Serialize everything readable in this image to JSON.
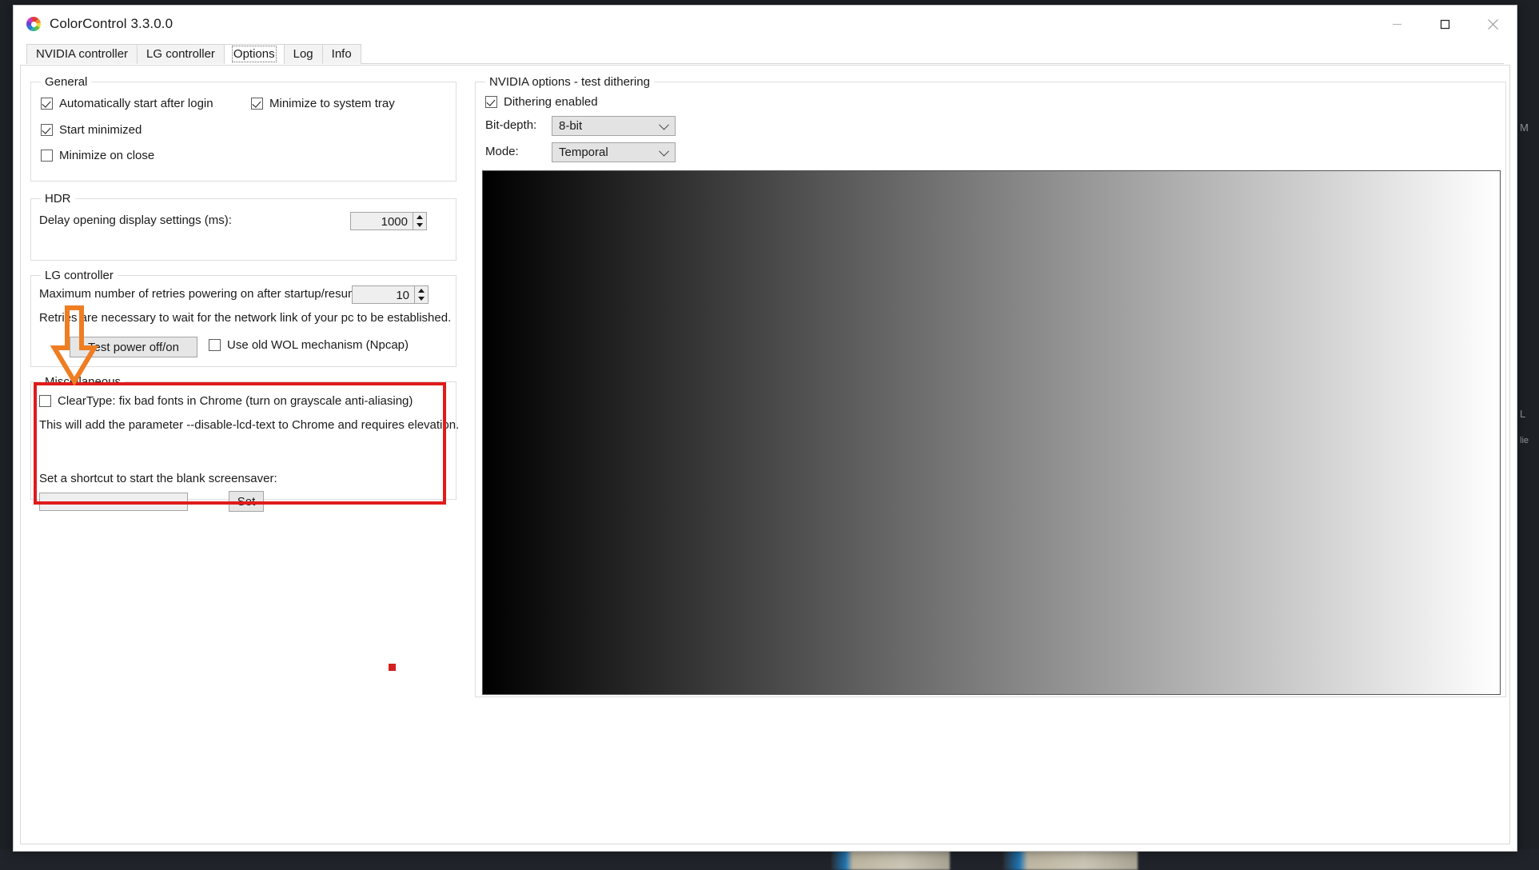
{
  "window": {
    "title": "ColorControl 3.3.0.0",
    "icon": "color-wheel-icon",
    "controls": {
      "minimize": "minimize-icon",
      "maximize": "maximize-icon",
      "close": "close-icon"
    }
  },
  "tabs": [
    {
      "label": "NVIDIA controller",
      "selected": false
    },
    {
      "label": "LG controller",
      "selected": false
    },
    {
      "label": "Options",
      "selected": true
    },
    {
      "label": "Log",
      "selected": false
    },
    {
      "label": "Info",
      "selected": false
    }
  ],
  "general": {
    "title": "General",
    "items": [
      {
        "label": "Automatically start after login",
        "checked": true
      },
      {
        "label": "Minimize to system tray",
        "checked": true
      },
      {
        "label": "Start minimized",
        "checked": true
      },
      {
        "label": "Minimize on close",
        "checked": false
      }
    ]
  },
  "hdr": {
    "title": "HDR",
    "delay_label": "Delay opening display settings (ms):",
    "delay_value": "1000"
  },
  "lg": {
    "title": "LG controller",
    "retries_label": "Maximum number of retries powering on after startup/resume:",
    "retries_value": "10",
    "note": "Retries are necessary to wait for the network link of your pc to be established.",
    "test_button": "Test power off/on",
    "wol_label": "Use old WOL mechanism (Npcap)",
    "wol_checked": false
  },
  "misc": {
    "title": "Miscellaneous",
    "cleartype_label": "ClearType: fix bad fonts in Chrome (turn on grayscale anti-aliasing)",
    "cleartype_checked": false,
    "cleartype_note": "This will add the parameter --disable-lcd-text to Chrome and requires elevation.",
    "shortcut_label": "Set a shortcut to start the blank screensaver:",
    "shortcut_value": "",
    "shortcut_placeholder": "",
    "set_button": "Set"
  },
  "nvidia": {
    "title": "NVIDIA options - test dithering",
    "dithering_label": "Dithering enabled",
    "dithering_checked": true,
    "bitdepth_label": "Bit-depth:",
    "bitdepth_value": "8-bit",
    "mode_label": "Mode:",
    "mode_value": "Temporal",
    "gradient": {
      "from": "#000000",
      "to": "#ffffff"
    }
  },
  "annotations": {
    "highlight_color": "#e01b1b",
    "arrow_color": "#ef7d22",
    "dot_color": "#d32020"
  },
  "desktop": {
    "fragments": [
      "M",
      "L",
      "lie"
    ]
  }
}
